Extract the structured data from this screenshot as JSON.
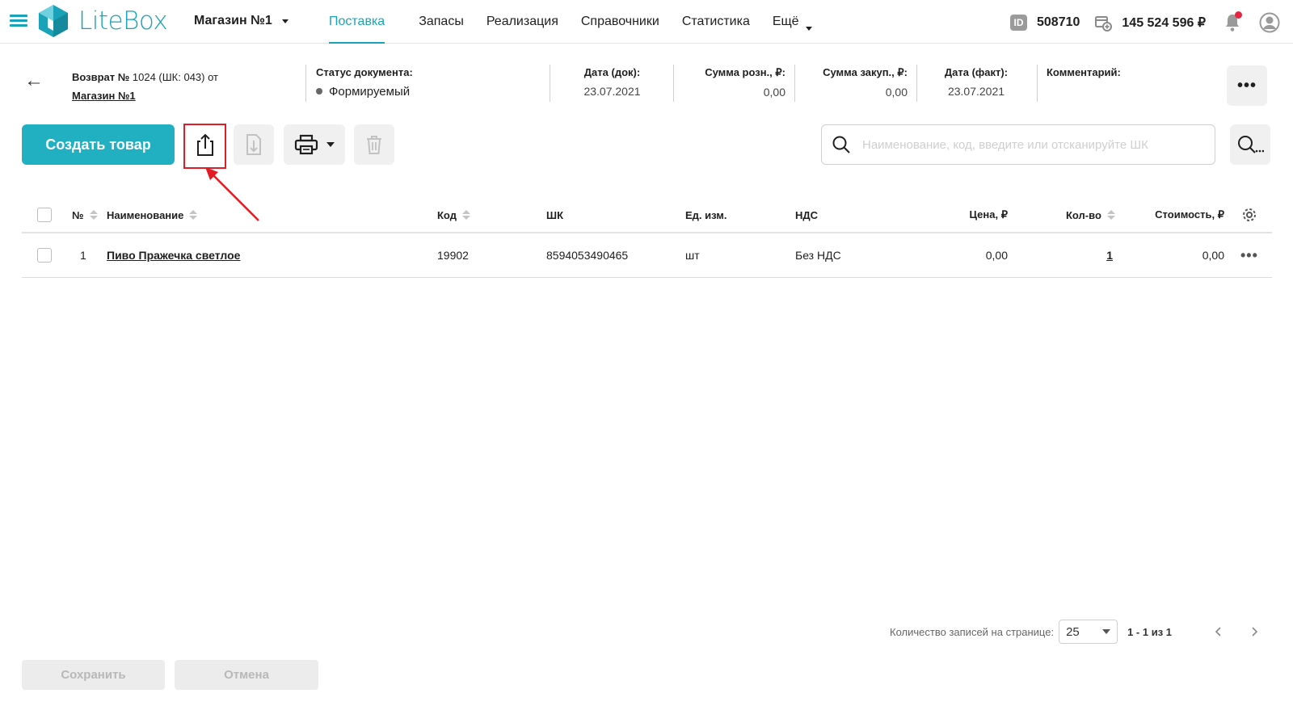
{
  "app": {
    "logo_text": "LiteBox",
    "accent_color": "#1aa3b8"
  },
  "header": {
    "store": "Магазин №1",
    "nav": [
      {
        "label": "Поставка",
        "active": true
      },
      {
        "label": "Запасы"
      },
      {
        "label": "Реализация"
      },
      {
        "label": "Справочники"
      },
      {
        "label": "Статистика"
      },
      {
        "label": "Ещё"
      }
    ],
    "id_badge": "ID",
    "account_id": "508710",
    "balance": "145 524 596 ₽"
  },
  "document": {
    "title": "Возврат № 1024 (ШК: 043) от",
    "title_bold_prefix": "Возврат №",
    "title_rest": "1024 (ШК: 043) от",
    "store_link": "Магазин №1",
    "status_label": "Статус документа:",
    "status_value": "Формируемый",
    "doc_date_label": "Дата (док):",
    "doc_date_value": "23.07.2021",
    "retail_sum_label": "Сумма розн., ₽:",
    "retail_sum_value": "0,00",
    "purchase_sum_label": "Сумма закуп., ₽:",
    "purchase_sum_value": "0,00",
    "fact_date_label": "Дата (факт):",
    "fact_date_value": "23.07.2021",
    "comment_label": "Комментарий:",
    "more": "•••"
  },
  "toolbar": {
    "create_label": "Создать товар",
    "search_placeholder": "Наименование, код, введите или отсканируйте ШК"
  },
  "table": {
    "columns": [
      "№",
      "Наименование",
      "Код",
      "ШК",
      "Ед. изм.",
      "НДС",
      "Цена, ₽",
      "Кол-во",
      "Стоимость, ₽"
    ],
    "rows": [
      {
        "num": "1",
        "name": "Пиво Пражечка светлое",
        "code": "19902",
        "barcode": "8594053490465",
        "unit": "шт",
        "vat": "Без НДС",
        "price": "0,00",
        "qty": "1",
        "cost": "0,00",
        "more": "•••"
      }
    ]
  },
  "pagination": {
    "label": "Количество записей на странице:",
    "per_page": "25",
    "range": "1 - 1 из 1"
  },
  "footer": {
    "save_label": "Сохранить",
    "cancel_label": "Отмена"
  }
}
